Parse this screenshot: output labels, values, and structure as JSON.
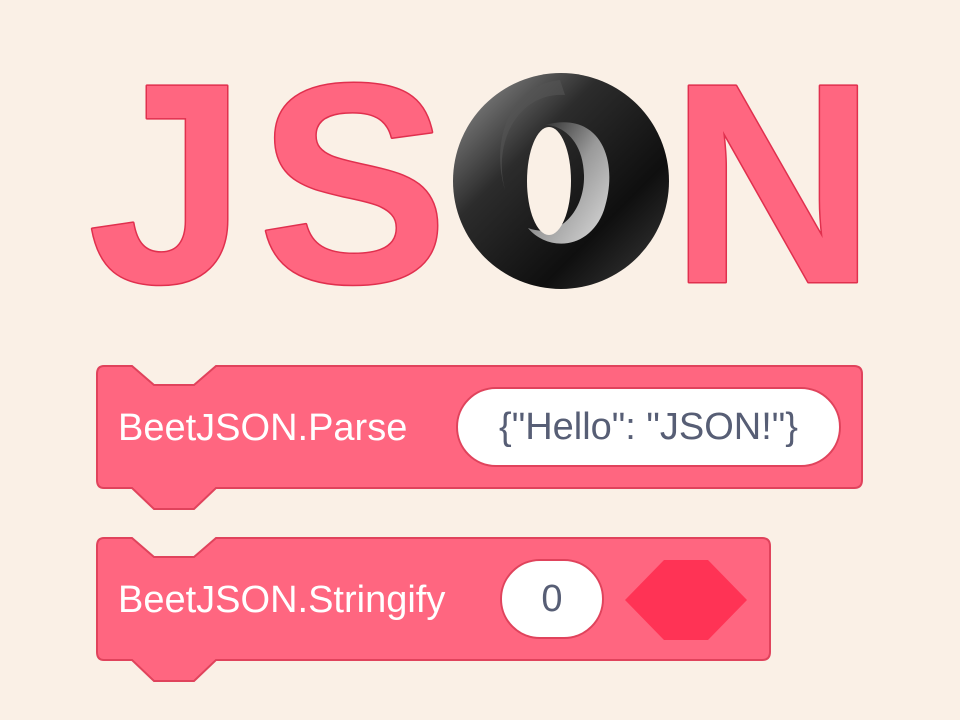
{
  "logo": {
    "letters": [
      "J",
      "S",
      "N"
    ],
    "icon": "json-ring-icon"
  },
  "blocks": {
    "parse": {
      "label": "BeetJSON.Parse",
      "input_value": "{\"Hello\": \"JSON!\"}"
    },
    "stringify": {
      "label": "BeetJSON.Stringify",
      "input_value": "0",
      "slot_icon": "hexagon-slot-icon"
    }
  },
  "colors": {
    "background": "#faf0e6",
    "block_fill": "#ff6680",
    "block_border": "#e0435c",
    "slot_hexagon": "#ff3355",
    "input_text": "#575e75"
  }
}
